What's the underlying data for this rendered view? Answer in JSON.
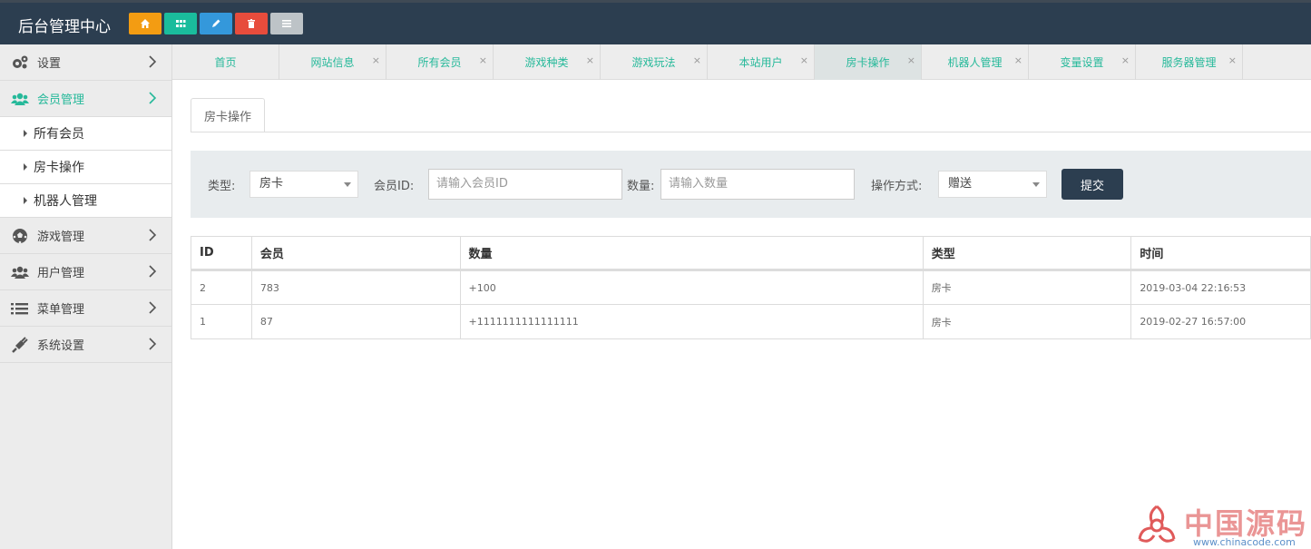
{
  "header": {
    "title": "后台管理中心",
    "buttons": [
      {
        "icon": "home-icon",
        "color": "#f39c12"
      },
      {
        "icon": "grid-icon",
        "color": "#1abc9c"
      },
      {
        "icon": "pencil-icon",
        "color": "#3498db"
      },
      {
        "icon": "trash-icon",
        "color": "#e74c3c"
      },
      {
        "icon": "list-icon",
        "color": "#bdc3c7"
      }
    ]
  },
  "sidebar": {
    "items": [
      {
        "label": "设置",
        "icon": "gears-icon"
      },
      {
        "label": "会员管理",
        "icon": "users-icon",
        "active": true
      },
      {
        "label": "游戏管理",
        "icon": "soccer-icon"
      },
      {
        "label": "用户管理",
        "icon": "users-icon"
      },
      {
        "label": "菜单管理",
        "icon": "list-icon"
      },
      {
        "label": "系统设置",
        "icon": "plug-icon"
      }
    ],
    "subitems": [
      "所有会员",
      "房卡操作",
      "机器人管理"
    ]
  },
  "tabs": [
    {
      "label": "首页",
      "closable": false
    },
    {
      "label": "网站信息",
      "closable": true
    },
    {
      "label": "所有会员",
      "closable": true
    },
    {
      "label": "游戏种类",
      "closable": true
    },
    {
      "label": "游戏玩法",
      "closable": true
    },
    {
      "label": "本站用户",
      "closable": true
    },
    {
      "label": "房卡操作",
      "closable": true,
      "active": true
    },
    {
      "label": "机器人管理",
      "closable": true
    },
    {
      "label": "变量设置",
      "closable": true
    },
    {
      "label": "服务器管理",
      "closable": true
    }
  ],
  "close_glyph": "×",
  "panel": {
    "tab_label": "房卡操作"
  },
  "form": {
    "type_label": "类型:",
    "type_value": "房卡",
    "member_label": "会员ID:",
    "member_placeholder": "请输入会员ID",
    "qty_label": "数量:",
    "qty_placeholder": "请输入数量",
    "op_label": "操作方式:",
    "op_value": "赠送",
    "submit_label": "提交"
  },
  "table": {
    "headers": [
      "ID",
      "会员",
      "数量",
      "类型",
      "时间"
    ],
    "rows": [
      [
        "2",
        "783",
        "+100",
        "房卡",
        "2019-03-04 22:16:53"
      ],
      [
        "1",
        "87",
        "+1111111111111111",
        "房卡",
        "2019-02-27 16:57:00"
      ]
    ]
  },
  "watermark": {
    "text": "中国源码",
    "url": "www.chinacode.com"
  },
  "colors": {
    "accent": "#26b99a",
    "header_bg": "#2c3e50"
  }
}
